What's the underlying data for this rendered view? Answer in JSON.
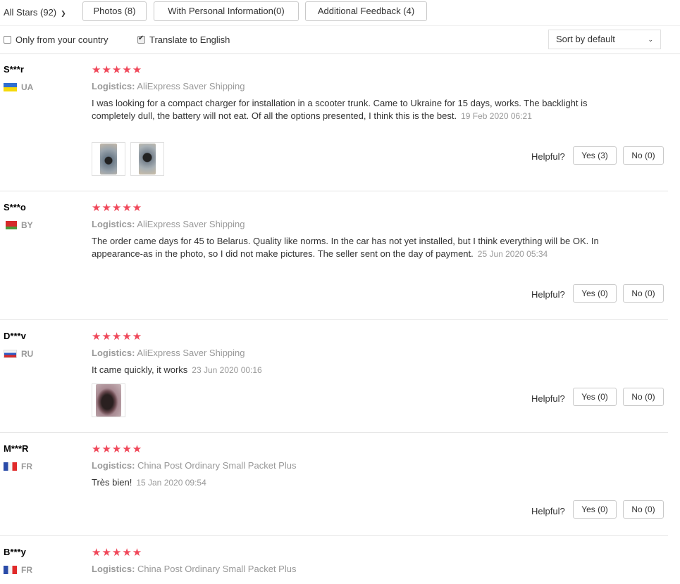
{
  "filters": {
    "all_stars": "All Stars (92)",
    "chevron_icon": "chevron-down-icon",
    "tabs": [
      "Photos (8)",
      "With Personal Information(0)",
      "Additional Feedback (4)"
    ],
    "only_country": "Only from your country",
    "translate": "Translate to English",
    "translate_checked": true,
    "sort": "Sort by default"
  },
  "ui": {
    "star_color": "#f0485a",
    "helpful_label": "Helpful?"
  },
  "reviews": [
    {
      "user": "S***r",
      "country": "UA",
      "stars": "★★★★★",
      "logistics_label": "Logistics:",
      "logistics": "AliExpress Saver Shipping",
      "text": "I was looking for a compact charger for installation in a scooter trunk. Came to Ukraine for 15 days, works. The backlight is completely dull, the battery will not eat. Of all the options presented, I think this is the best.",
      "date": "19 Feb 2020 06:21",
      "yes": "Yes (3)",
      "no": "No (0)"
    },
    {
      "user": "S***o",
      "country": "BY",
      "stars": "★★★★★",
      "logistics_label": "Logistics:",
      "logistics": "AliExpress Saver Shipping",
      "text": "The order came days for 45 to Belarus. Quality like norms. In the car has not yet installed, but I think everything will be OK. In appearance-as in the photo, so I did not make pictures. The seller sent on the day of payment.",
      "date": "25 Jun 2020 05:34",
      "yes": "Yes (0)",
      "no": "No (0)"
    },
    {
      "user": "D***v",
      "country": "RU",
      "stars": "★★★★★",
      "logistics_label": "Logistics:",
      "logistics": "AliExpress Saver Shipping",
      "text": "It came quickly, it works",
      "date": "23 Jun 2020 00:16",
      "yes": "Yes (0)",
      "no": "No (0)"
    },
    {
      "user": "M***R",
      "country": "FR",
      "stars": "★★★★★",
      "logistics_label": "Logistics:",
      "logistics": "China Post Ordinary Small Packet Plus",
      "text": "Très bien!",
      "date": "15 Jan 2020 09:54",
      "yes": "Yes (0)",
      "no": "No (0)"
    },
    {
      "user": "B***y",
      "country": "FR",
      "stars": "★★★★★",
      "logistics_label": "Logistics:",
      "logistics": "China Post Ordinary Small Packet Plus"
    }
  ]
}
